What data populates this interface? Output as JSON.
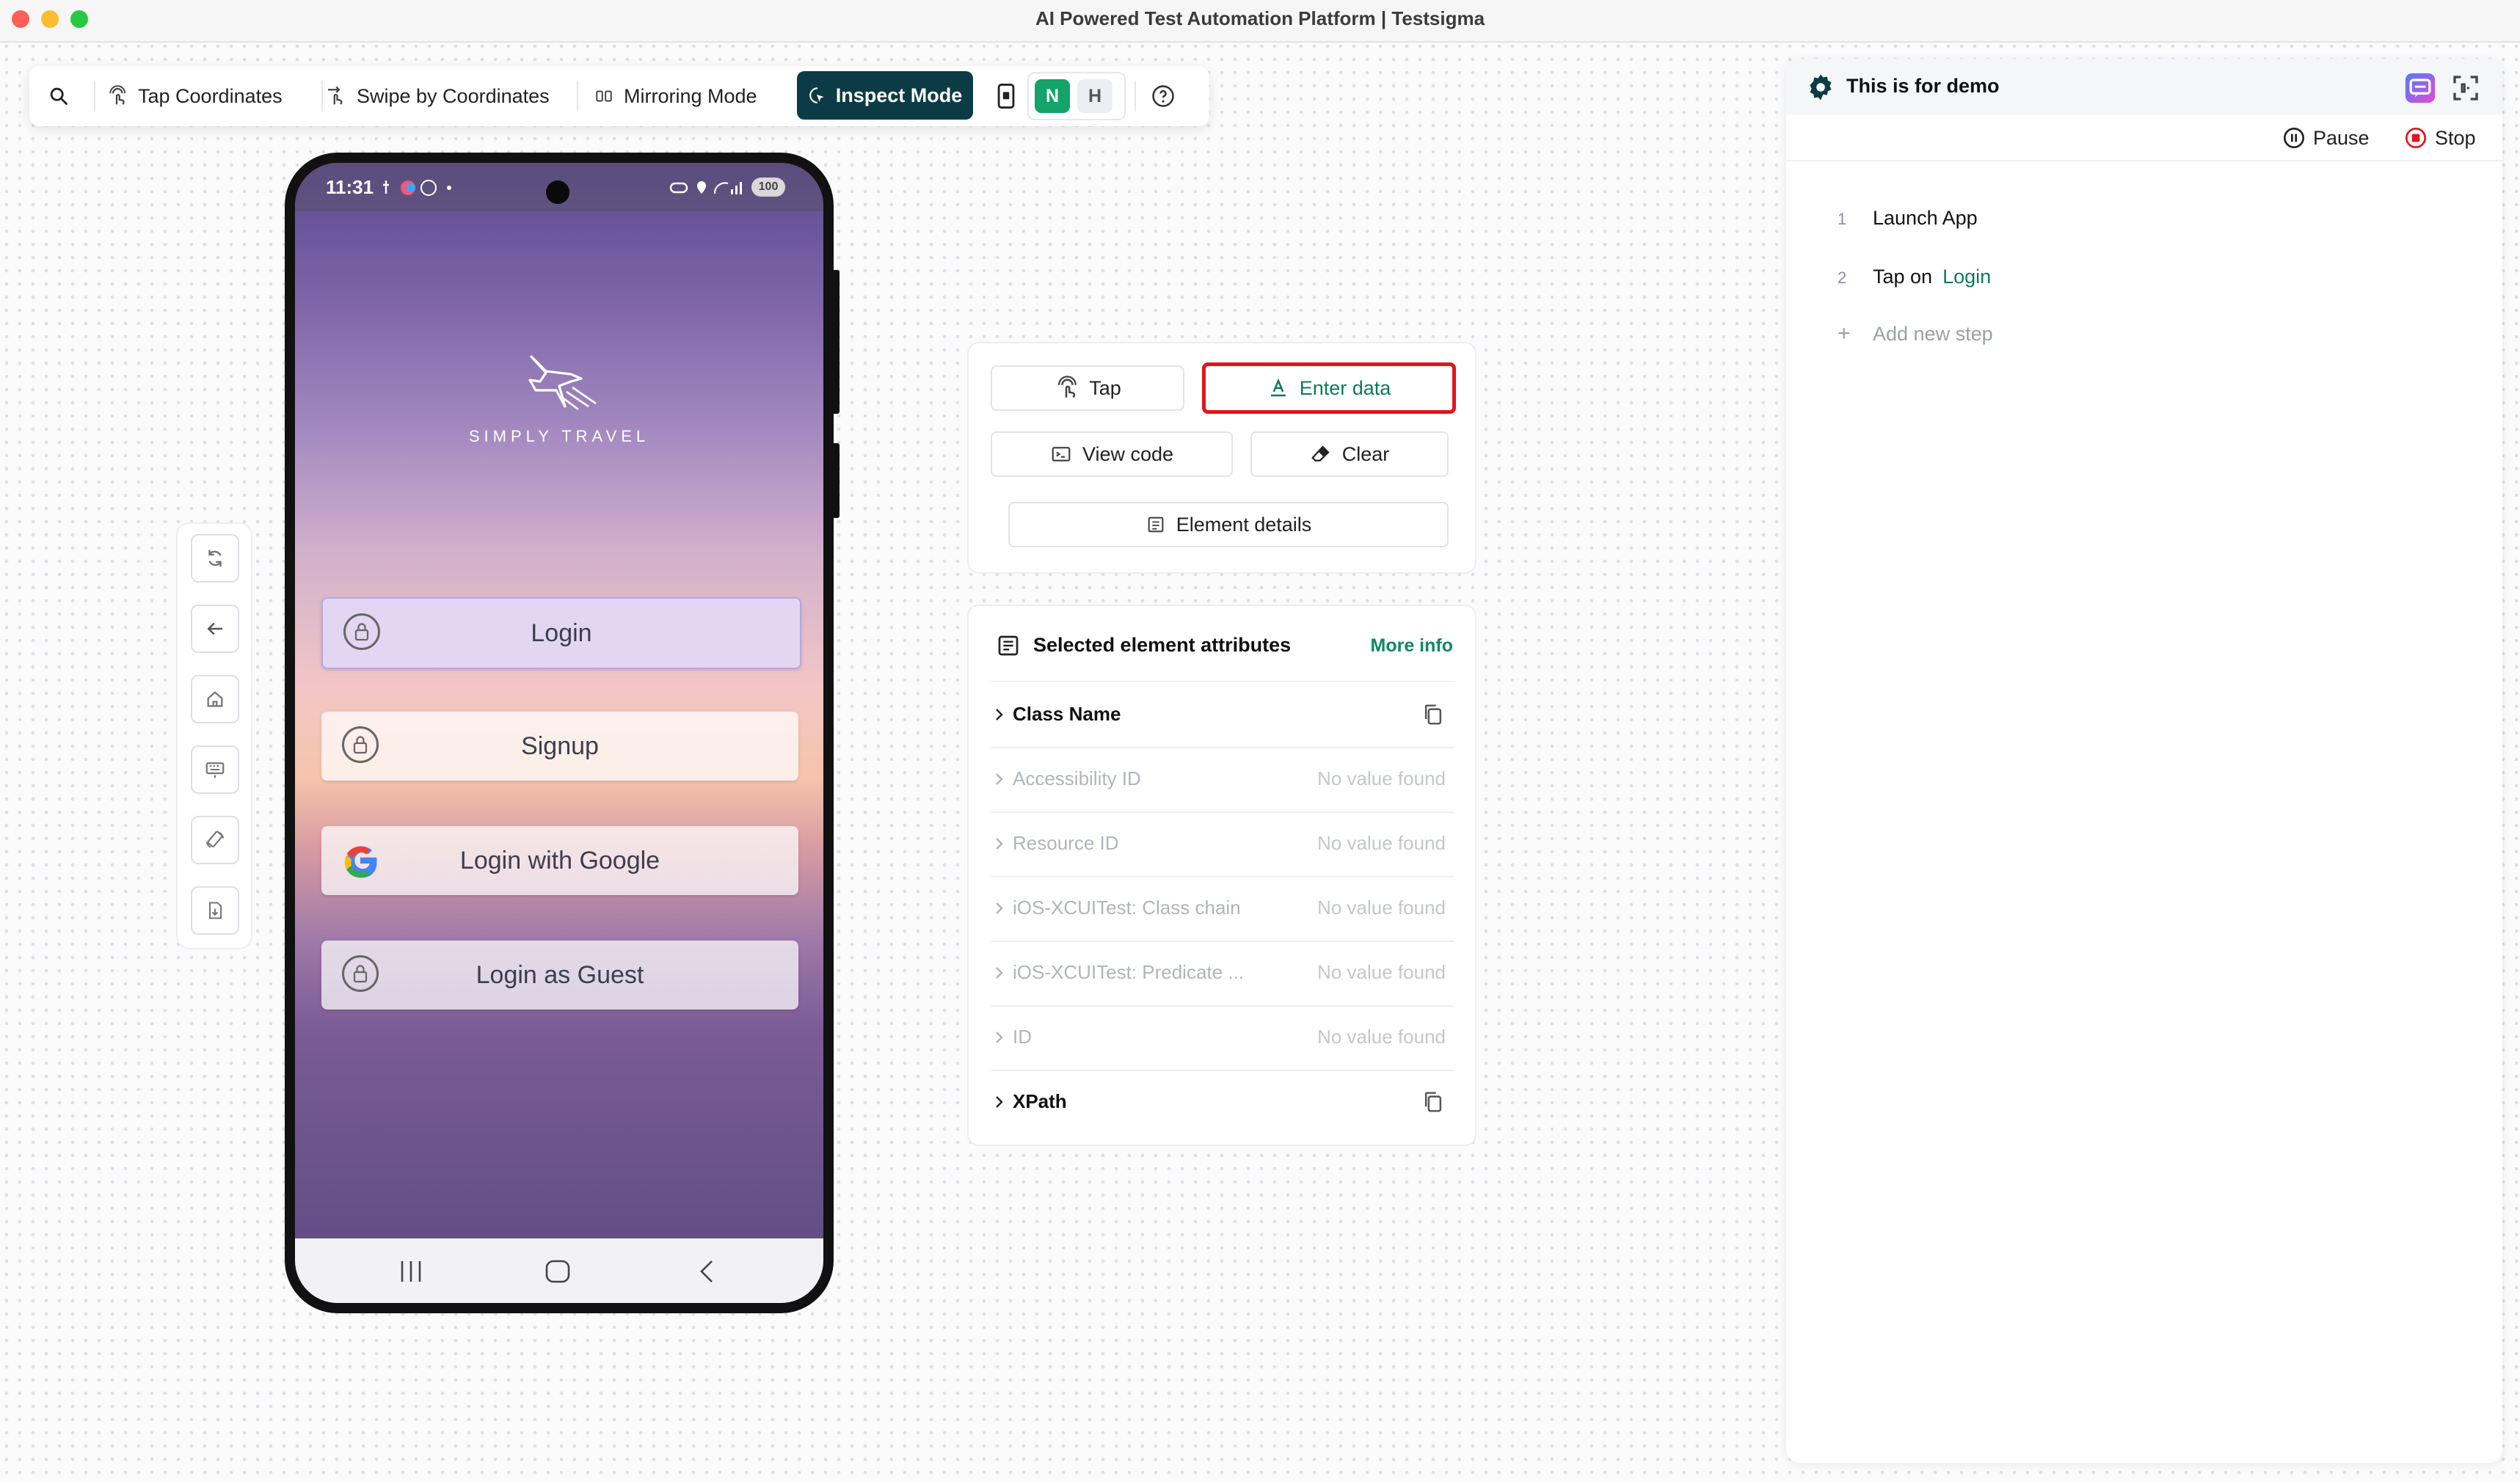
{
  "window": {
    "title": "AI Powered Test Automation Platform | Testsigma"
  },
  "toolbar": {
    "tap_coordinates": "Tap Coordinates",
    "swipe_by_coordinates": "Swipe by Coordinates",
    "mirroring_mode": "Mirroring Mode",
    "inspect_mode": "Inspect Mode",
    "toggle_n": "N",
    "toggle_h": "H"
  },
  "device": {
    "status_time": "11:31",
    "battery": "100",
    "brand": "SIMPLY TRAVEL",
    "buttons": [
      "Login",
      "Signup",
      "Login with Google",
      "Login as Guest"
    ]
  },
  "actions": {
    "tap": "Tap",
    "enter_data": "Enter data",
    "view_code": "View code",
    "clear": "Clear",
    "element_details": "Element details"
  },
  "attributes": {
    "title": "Selected element attributes",
    "more_info": "More info",
    "rows": [
      {
        "name": "Class Name",
        "value": ""
      },
      {
        "name": "Accessibility ID",
        "value": "No value found"
      },
      {
        "name": "Resource ID",
        "value": "No value found"
      },
      {
        "name": "iOS-XCUITest: Class chain",
        "value": "No value found"
      },
      {
        "name": "iOS-XCUITest: Predicate ...",
        "value": "No value found"
      },
      {
        "name": "ID",
        "value": "No value found"
      },
      {
        "name": "XPath",
        "value": ""
      }
    ]
  },
  "recorder": {
    "title": "This is for demo",
    "pause": "Pause",
    "stop": "Stop",
    "steps": [
      {
        "num": "1",
        "text": "Launch App",
        "target": ""
      },
      {
        "num": "2",
        "text": "Tap on",
        "target": "Login"
      }
    ],
    "add_step": "Add new step"
  },
  "colors": {
    "accent": "#0d3b45",
    "green": "#13a36b",
    "highlight": "#e3141b"
  }
}
